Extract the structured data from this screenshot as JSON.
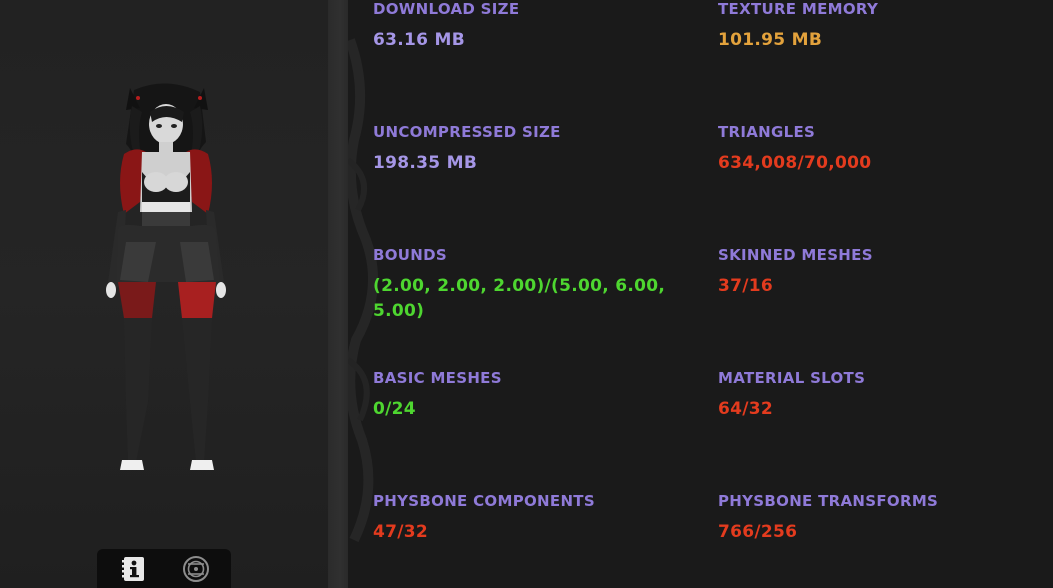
{
  "colors": {
    "label": "#8f7ad8",
    "value_neutral": "#a596e6",
    "value_warning": "#e3a23c",
    "value_bad": "#e33b1e",
    "value_good": "#4ed630"
  },
  "stats": [
    {
      "label": "DOWNLOAD SIZE",
      "value": "63.16 MB",
      "status": "neutral"
    },
    {
      "label": "TEXTURE MEMORY",
      "value": "101.95 MB",
      "status": "warning"
    },
    {
      "label": "UNCOMPRESSED SIZE",
      "value": "198.35 MB",
      "status": "neutral"
    },
    {
      "label": "TRIANGLES",
      "value": "634,008/70,000",
      "status": "bad"
    },
    {
      "label": "BOUNDS",
      "value": "(2.00, 2.00, 2.00)/(5.00, 6.00, 5.00)",
      "status": "good"
    },
    {
      "label": "SKINNED MESHES",
      "value": "37/16",
      "status": "bad"
    },
    {
      "label": "BASIC MESHES",
      "value": "0/24",
      "status": "good"
    },
    {
      "label": "MATERIAL SLOTS",
      "value": "64/32",
      "status": "bad"
    },
    {
      "label": "PHYSBONE COMPONENTS",
      "value": "47/32",
      "status": "bad"
    },
    {
      "label": "PHYSBONE TRANSFORMS",
      "value": "766/256",
      "status": "bad"
    }
  ],
  "tabs": [
    {
      "icon": "info-icon",
      "active": true
    },
    {
      "icon": "avatar-stats-icon",
      "active": false
    }
  ]
}
